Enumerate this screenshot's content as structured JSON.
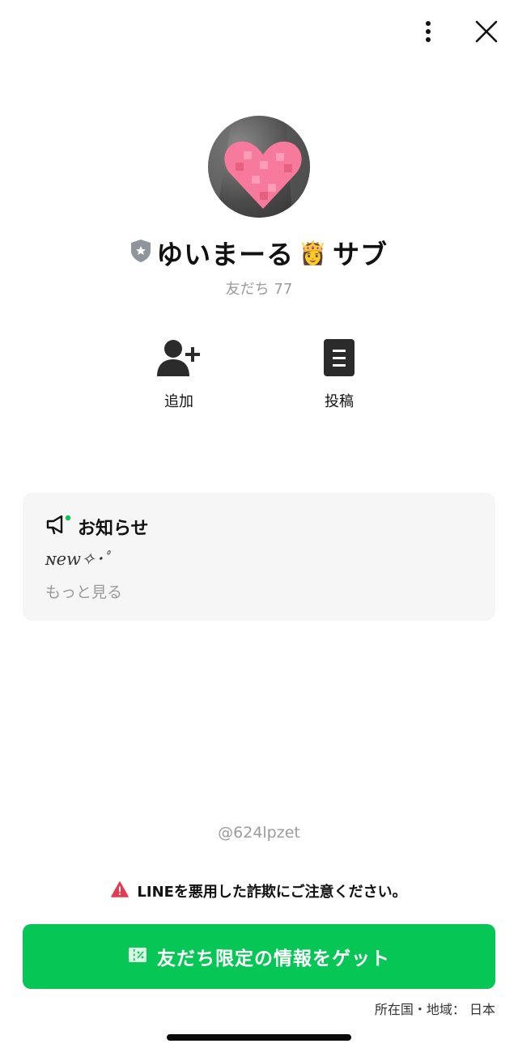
{
  "header": {
    "more_icon": "vertical-dots-icon",
    "close_icon": "close-icon"
  },
  "profile": {
    "badge_icon": "shield-badge-icon",
    "name_main": "ゆいまーる",
    "name_emoji": "👸",
    "name_suffix": "サブ",
    "friends_label": "友だち 77"
  },
  "actions": [
    {
      "label": "追加",
      "icon": "add-friend-icon"
    },
    {
      "label": "投稿",
      "icon": "posts-icon"
    }
  ],
  "notice": {
    "icon": "megaphone-icon",
    "title": "お知らせ",
    "body": "ɴew✧･ﾟ",
    "more": "もっと見る"
  },
  "line_id": "@624lpzet",
  "warning": {
    "icon": "warning-icon",
    "text": "LINEを悪用した詐欺にご注意ください。"
  },
  "cta": {
    "icon": "coupon-icon",
    "label": "友だち限定の情報をゲット"
  },
  "region": "所在国・地域： 日本",
  "colors": {
    "brand_green": "#06c755",
    "warning_red": "#e8384f",
    "muted_gray": "#9c9c9c"
  }
}
